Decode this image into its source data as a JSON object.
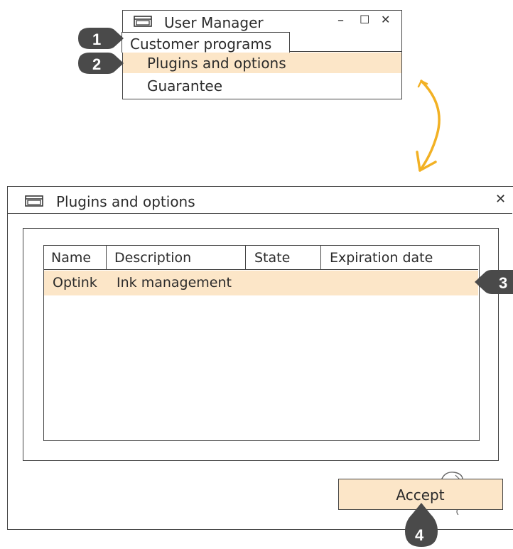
{
  "menu_window": {
    "title": "User Manager",
    "controls": {
      "minimize": "–",
      "maximize": "☐",
      "close": "✕"
    },
    "items": [
      {
        "label": "Customer programs"
      },
      {
        "label": "Plugins and options",
        "highlighted": true
      },
      {
        "label": "Guarantee"
      }
    ]
  },
  "dialog": {
    "title": "Plugins and options",
    "close": "✕",
    "table": {
      "columns": [
        "Name",
        "Description",
        "State",
        "Expiration date"
      ],
      "rows": [
        {
          "name": "Optink",
          "description": "Ink management",
          "state": "",
          "expiration": "",
          "highlighted": true
        }
      ]
    },
    "accept_label": "Accept"
  },
  "markers": [
    "1",
    "2",
    "3",
    "4"
  ],
  "colors": {
    "highlight": "#fce6c8",
    "arrow": "#f2b124",
    "marker": "#4a4a4a"
  },
  "icons": {
    "window": "window-icon",
    "flow_arrow": "arrow-down-icon"
  }
}
